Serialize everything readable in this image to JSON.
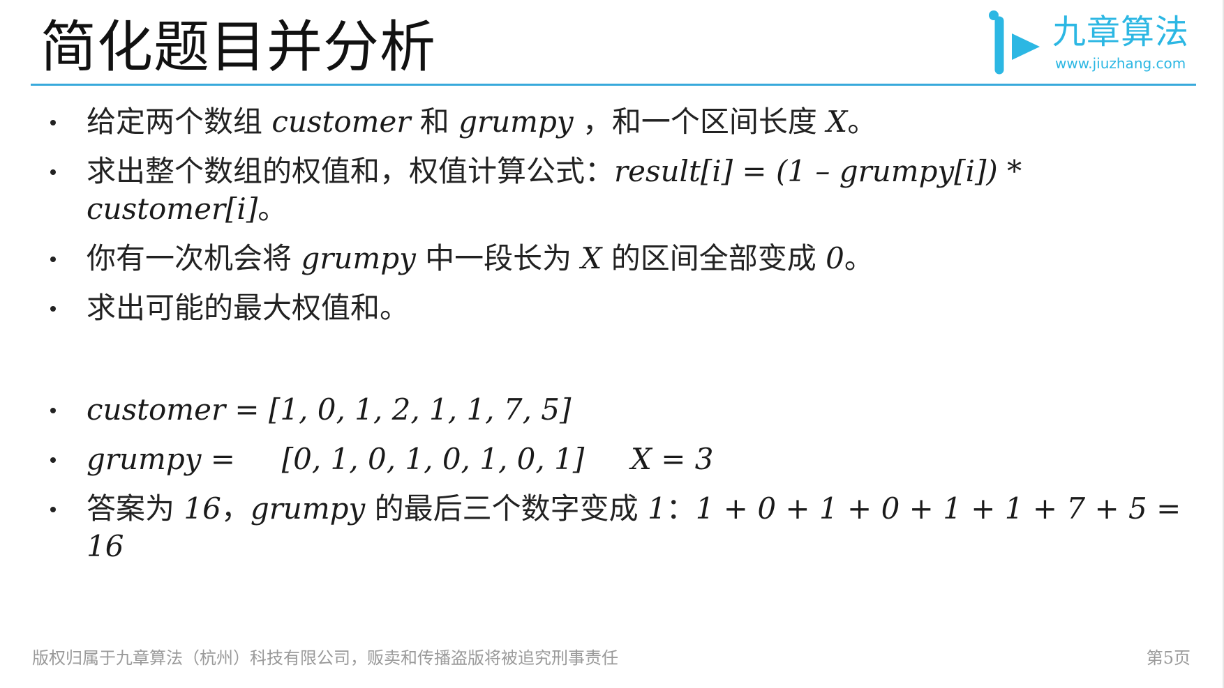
{
  "slide": {
    "title": "简化题目并分析",
    "logo": {
      "name": "九章算法",
      "url": "www.jiuzhang.com",
      "accent_color": "#2cb7e3"
    },
    "rule_color": "#38a9db",
    "bullets": [
      {
        "parts": [
          "给定两个数组 ",
          "customer",
          " 和 ",
          "grumpy",
          " ，和一个区间长度 ",
          "X",
          "。"
        ]
      },
      {
        "parts": [
          "求出整个数组的权值和，权值计算公式：",
          "result[i] = (1 – grumpy[i]) * customer[i]",
          "。"
        ]
      },
      {
        "parts": [
          "你有一次机会将 ",
          "grumpy",
          " 中一段长为 ",
          "X",
          " 的区间全部变成 ",
          "0",
          "。"
        ]
      },
      {
        "parts": [
          "求出可能的最大权值和。"
        ]
      },
      {
        "parts": [
          "",
          "customer = [1, 0, 1, 2, 1, 1, 7, 5]",
          ""
        ]
      },
      {
        "parts": [
          "",
          "grumpy =     [0, 1, 0, 1, 0, 1, 0, 1]     X = 3",
          ""
        ]
      },
      {
        "parts": [
          "答案为 ",
          "16",
          "，",
          "grumpy",
          " 的最后三个数字变成 ",
          "1",
          "：",
          "1 + 0 + 1 + 0 + 1 + 1 + 7 + 5 = 16",
          ""
        ]
      }
    ],
    "footer": {
      "copyright": "版权归属于九章算法（杭州）科技有限公司，贩卖和传播盗版将被追究刑事责任",
      "page": "第5页"
    }
  }
}
